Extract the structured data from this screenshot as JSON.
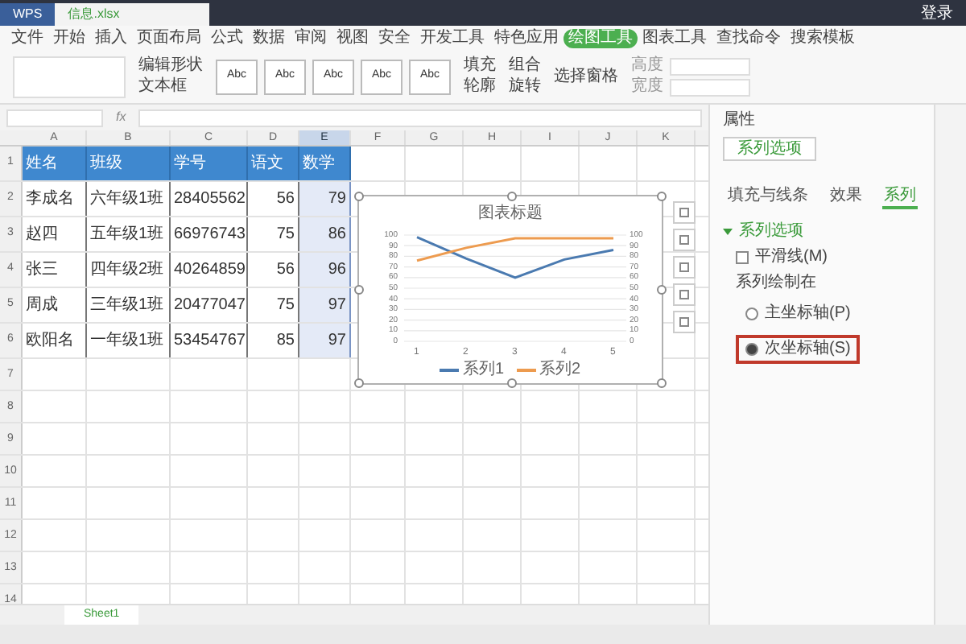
{
  "window": {
    "app_tab": "WPS",
    "file_tab": "信息.xlsx",
    "login": "登录"
  },
  "menu": [
    {
      "label": "文件",
      "selected": false
    },
    {
      "label": "开始",
      "selected": false
    },
    {
      "label": "插入",
      "selected": false
    },
    {
      "label": "页面布局",
      "selected": false
    },
    {
      "label": "公式",
      "selected": false
    },
    {
      "label": "数据",
      "selected": false
    },
    {
      "label": "审阅",
      "selected": false
    },
    {
      "label": "视图",
      "selected": false
    },
    {
      "label": "安全",
      "selected": false
    },
    {
      "label": "开发工具",
      "selected": false
    },
    {
      "label": "特色应用",
      "selected": false
    },
    {
      "label": "绘图工具",
      "selected": true
    },
    {
      "label": "图表工具",
      "selected": false
    },
    {
      "label": "查找命令",
      "selected": false
    },
    {
      "label": "搜索模板",
      "selected": false
    }
  ],
  "ribbon": {
    "edit_shape": "编辑形状",
    "text_box": "文本框",
    "style_presets": [
      "Abc",
      "Abc",
      "Abc",
      "Abc",
      "Abc"
    ],
    "fill": "填充",
    "outline": "轮廓",
    "group": "组合",
    "rotate": "旋转",
    "selection_pane": "选择窗格",
    "height": "高度",
    "width": "宽度"
  },
  "formula_bar": {
    "fx": "fx"
  },
  "sheet": {
    "columns": [
      {
        "label": "A",
        "selected": false
      },
      {
        "label": "B",
        "selected": false
      },
      {
        "label": "C",
        "selected": false
      },
      {
        "label": "D",
        "selected": false
      },
      {
        "label": "E",
        "selected": true
      },
      {
        "label": "F",
        "selected": false
      },
      {
        "label": "G",
        "selected": false
      },
      {
        "label": "H",
        "selected": false
      },
      {
        "label": "I",
        "selected": false
      },
      {
        "label": "J",
        "selected": false
      },
      {
        "label": "K",
        "selected": false
      }
    ],
    "rows": [
      {
        "header": "1",
        "cells": [
          "姓名",
          "班级",
          "学号",
          "语文",
          "数学"
        ]
      },
      {
        "header": "2",
        "cells": [
          "李成名",
          "六年级1班",
          "28405562",
          "56",
          "79"
        ]
      },
      {
        "header": "3",
        "cells": [
          "赵四",
          "五年级1班",
          "66976743",
          "75",
          "86"
        ]
      },
      {
        "header": "4",
        "cells": [
          "张三",
          "四年级2班",
          "40264859",
          "56",
          "96"
        ]
      },
      {
        "header": "5",
        "cells": [
          "周成",
          "三年级1班",
          "20477047",
          "75",
          "97"
        ]
      },
      {
        "header": "6",
        "cells": [
          "欧阳名",
          "一年级1班",
          "53454767",
          "85",
          "97"
        ]
      },
      {
        "header": "7"
      },
      {
        "header": "8"
      },
      {
        "header": "9"
      },
      {
        "header": "10"
      },
      {
        "header": "11"
      },
      {
        "header": "12"
      },
      {
        "header": "13"
      },
      {
        "header": "14"
      }
    ]
  },
  "chart": {
    "chart_data": {
      "type": "line",
      "title": "图表标题",
      "categories": [
        "1",
        "2",
        "3",
        "4",
        "5"
      ],
      "series": [
        {
          "name": "系列1",
          "color": "#4a7ab0",
          "values": [
            98,
            78,
            60,
            77,
            86
          ]
        },
        {
          "name": "系列2",
          "color": "#ed9b4f",
          "values": [
            76,
            88,
            97,
            97,
            97
          ]
        }
      ],
      "ylim": [
        0,
        100
      ],
      "yticks": [
        0,
        10,
        20,
        30,
        40,
        50,
        60,
        70,
        80,
        90,
        100
      ],
      "grid": true,
      "legend": "bottom"
    },
    "right_axis_ticks": [
      "100",
      "90",
      "80",
      "70",
      "60",
      "50",
      "40",
      "30",
      "20",
      "10",
      "0"
    ]
  },
  "panel": {
    "title": "属性",
    "dropdown": "系列选项",
    "tabs": [
      {
        "label": "填充与线条",
        "selected": false
      },
      {
        "label": "效果",
        "selected": false
      },
      {
        "label": "系列",
        "selected": true
      }
    ],
    "section": {
      "label": "系列选项",
      "expanded": true
    },
    "smooth": {
      "label": "平滑线(M)",
      "checked": false
    },
    "plot_on": "系列绘制在",
    "axes": [
      {
        "label": "主坐标轴(P)",
        "selected": false
      },
      {
        "label": "次坐标轴(S)",
        "selected": true
      }
    ]
  },
  "sheet_tabs": [
    {
      "label": "Sheet1",
      "selected": true
    }
  ]
}
